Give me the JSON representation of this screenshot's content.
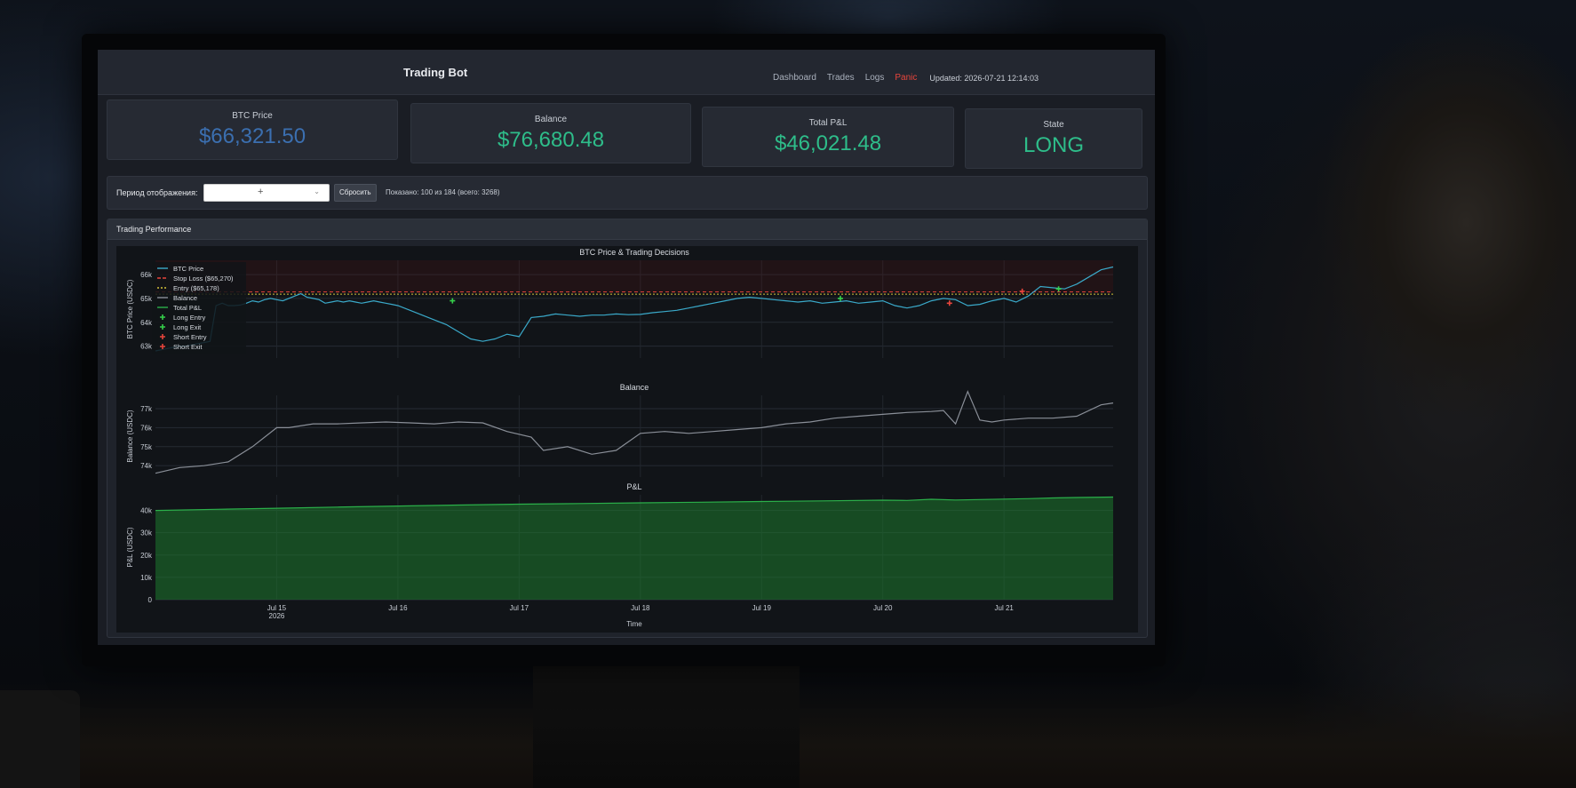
{
  "app": {
    "title": "Trading Bot",
    "nav": [
      "Dashboard",
      "Trades",
      "Logs",
      "Panic"
    ],
    "updated": "Updated: 2026-07-21 12:14:03"
  },
  "stats": [
    {
      "label": "BTC Price",
      "value": "$66,321.50"
    },
    {
      "label": "Balance",
      "value": "$76,680.48"
    },
    {
      "label": "Total P&L",
      "value": "$46,021.48"
    },
    {
      "label": "State",
      "value": "LONG"
    }
  ],
  "period": {
    "label": "Период отображения:",
    "select_value": "+",
    "reset_label": "Сбросить",
    "shown": "Показано: 100 из 184 (всего: 3268)"
  },
  "panel": {
    "title": "Trading Performance"
  },
  "colors": {
    "price": "#3aa9c9",
    "balance": "#8a8f98",
    "pnl": "#2bb04a",
    "stop": "#e8453c",
    "entry": "#d4c23a",
    "accent_blue": "#3b6fb0",
    "accent_green": "#2ebd8a"
  },
  "chart_data": [
    {
      "type": "line",
      "title": "BTC Price & Trading Decisions",
      "ylabel": "BTC Price (USDC)",
      "ylim": [
        62500,
        66600
      ],
      "yticks": [
        63000,
        64000,
        65000,
        66000
      ],
      "ytick_labels": [
        "63k",
        "64k",
        "65k",
        "66k"
      ],
      "legend": [
        "BTC Price",
        "Stop Loss ($65,270)",
        "Entry ($65,178)",
        "Balance",
        "Total P&L",
        "Long Entry",
        "Long Exit",
        "Short Entry",
        "Short Exit"
      ],
      "legend_position": "top-left",
      "hlines": [
        {
          "name": "Stop Loss ($65,270)",
          "y": 65270
        },
        {
          "name": "Entry ($65,178)",
          "y": 65178
        }
      ],
      "series": [
        {
          "name": "BTC Price",
          "x": [
            0,
            0.05,
            0.1,
            0.15,
            0.2,
            0.25,
            0.3,
            0.35,
            0.4,
            0.45,
            0.5,
            0.55,
            0.6,
            0.65,
            0.7,
            0.75,
            0.8,
            0.85,
            0.9,
            0.95,
            1.0,
            1.05,
            1.1,
            1.15,
            1.2,
            1.25,
            1.3,
            1.35,
            1.4,
            1.45,
            1.5,
            1.55,
            1.6,
            1.65,
            1.7,
            1.75,
            1.8,
            1.85,
            1.9,
            1.95,
            2.0,
            2.1,
            2.2,
            2.3,
            2.4,
            2.5,
            2.6,
            2.7,
            2.8,
            2.9,
            3.0,
            3.1,
            3.2,
            3.3,
            3.4,
            3.5,
            3.6,
            3.7,
            3.8,
            3.9,
            4.0,
            4.1,
            4.2,
            4.3,
            4.4,
            4.5,
            4.6,
            4.7,
            4.8,
            4.9,
            5.0,
            5.1,
            5.2,
            5.3,
            5.4,
            5.5,
            5.6,
            5.7,
            5.8,
            5.9,
            6.0,
            6.1,
            6.2,
            6.3,
            6.4,
            6.5,
            6.6,
            6.7,
            6.8,
            6.9,
            7.0,
            7.1,
            7.2,
            7.3,
            7.4,
            7.5,
            7.6,
            7.7,
            7.8,
            7.9
          ],
          "y": [
            62800,
            62850,
            62900,
            62950,
            63000,
            63000,
            63050,
            63100,
            63150,
            63200,
            64700,
            64800,
            64700,
            64700,
            64720,
            64800,
            64900,
            64850,
            64950,
            65000,
            64950,
            64900,
            65000,
            65100,
            65200,
            65050,
            65000,
            64950,
            64800,
            64850,
            64900,
            64850,
            64900,
            64850,
            64800,
            64850,
            64900,
            64850,
            64800,
            64750,
            64700,
            64500,
            64300,
            64100,
            63900,
            63600,
            63300,
            63200,
            63300,
            63500,
            63400,
            64200,
            64250,
            64350,
            64300,
            64250,
            64300,
            64300,
            64350,
            64320,
            64330,
            64400,
            64450,
            64500,
            64600,
            64700,
            64800,
            64900,
            65000,
            65050,
            65000,
            64950,
            64900,
            64850,
            64900,
            64800,
            64850,
            64900,
            64800,
            64850,
            64900,
            64700,
            64600,
            64700,
            64900,
            65000,
            64950,
            64700,
            64750,
            64900,
            65000,
            64850,
            65100,
            65500,
            65450,
            65400,
            65600,
            65900,
            66200,
            66320
          ]
        }
      ],
      "markers": [
        {
          "name": "Long Exit",
          "x": 2.45,
          "y": 64900
        },
        {
          "name": "Long Exit",
          "x": 5.65,
          "y": 65000
        },
        {
          "name": "Short Entry",
          "x": 6.55,
          "y": 64800
        },
        {
          "name": "Short Exit",
          "x": 7.15,
          "y": 65300
        },
        {
          "name": "Long Entry",
          "x": 7.45,
          "y": 65400
        }
      ]
    },
    {
      "type": "line",
      "title": "Balance",
      "ylabel": "Balance (USDC)",
      "ylim": [
        73400,
        77700
      ],
      "yticks": [
        74000,
        75000,
        76000,
        77000
      ],
      "ytick_labels": [
        "74k",
        "75k",
        "76k",
        "77k"
      ],
      "series": [
        {
          "name": "Balance",
          "x": [
            0,
            0.2,
            0.4,
            0.6,
            0.8,
            1.0,
            1.1,
            1.3,
            1.5,
            1.7,
            1.9,
            2.1,
            2.3,
            2.5,
            2.7,
            2.9,
            3.1,
            3.2,
            3.4,
            3.6,
            3.8,
            4.0,
            4.2,
            4.4,
            4.6,
            4.8,
            5.0,
            5.2,
            5.4,
            5.6,
            5.8,
            6.0,
            6.2,
            6.4,
            6.5,
            6.6,
            6.7,
            6.8,
            6.9,
            7.0,
            7.2,
            7.4,
            7.6,
            7.8,
            7.9
          ],
          "y": [
            73600,
            73900,
            74000,
            74200,
            75000,
            76000,
            76000,
            76200,
            76200,
            76250,
            76300,
            76250,
            76200,
            76300,
            76250,
            75800,
            75500,
            74800,
            75000,
            74600,
            74800,
            75700,
            75800,
            75700,
            75800,
            75900,
            76000,
            76200,
            76300,
            76500,
            76600,
            76700,
            76800,
            76850,
            76900,
            76200,
            77900,
            76400,
            76300,
            76400,
            76500,
            76500,
            76600,
            77200,
            77300
          ]
        }
      ]
    },
    {
      "type": "area",
      "title": "P&L",
      "ylabel": "P&L (USDC)",
      "xlabel": "Time",
      "ylim": [
        0,
        47000
      ],
      "yticks": [
        0,
        10000,
        20000,
        30000,
        40000
      ],
      "ytick_labels": [
        "0",
        "10k",
        "20k",
        "30k",
        "40k"
      ],
      "x_tick_labels": [
        "Jul 15\n2026",
        "Jul 16",
        "Jul 17",
        "Jul 18",
        "Jul 19",
        "Jul 20",
        "Jul 21"
      ],
      "x_tick_values": [
        1,
        2,
        3,
        4,
        5,
        6,
        7
      ],
      "series": [
        {
          "name": "Total P&L",
          "x": [
            0,
            0.5,
            1.0,
            1.5,
            2.0,
            2.5,
            3.0,
            3.5,
            4.0,
            4.5,
            5.0,
            5.5,
            6.0,
            6.2,
            6.4,
            6.6,
            6.8,
            7.0,
            7.2,
            7.4,
            7.6,
            7.9
          ],
          "y": [
            40000,
            40500,
            41000,
            41500,
            42000,
            42400,
            42800,
            43100,
            43400,
            43700,
            44000,
            44300,
            44600,
            44500,
            45000,
            44700,
            44900,
            45100,
            45300,
            45600,
            45800,
            46021
          ]
        }
      ]
    }
  ]
}
